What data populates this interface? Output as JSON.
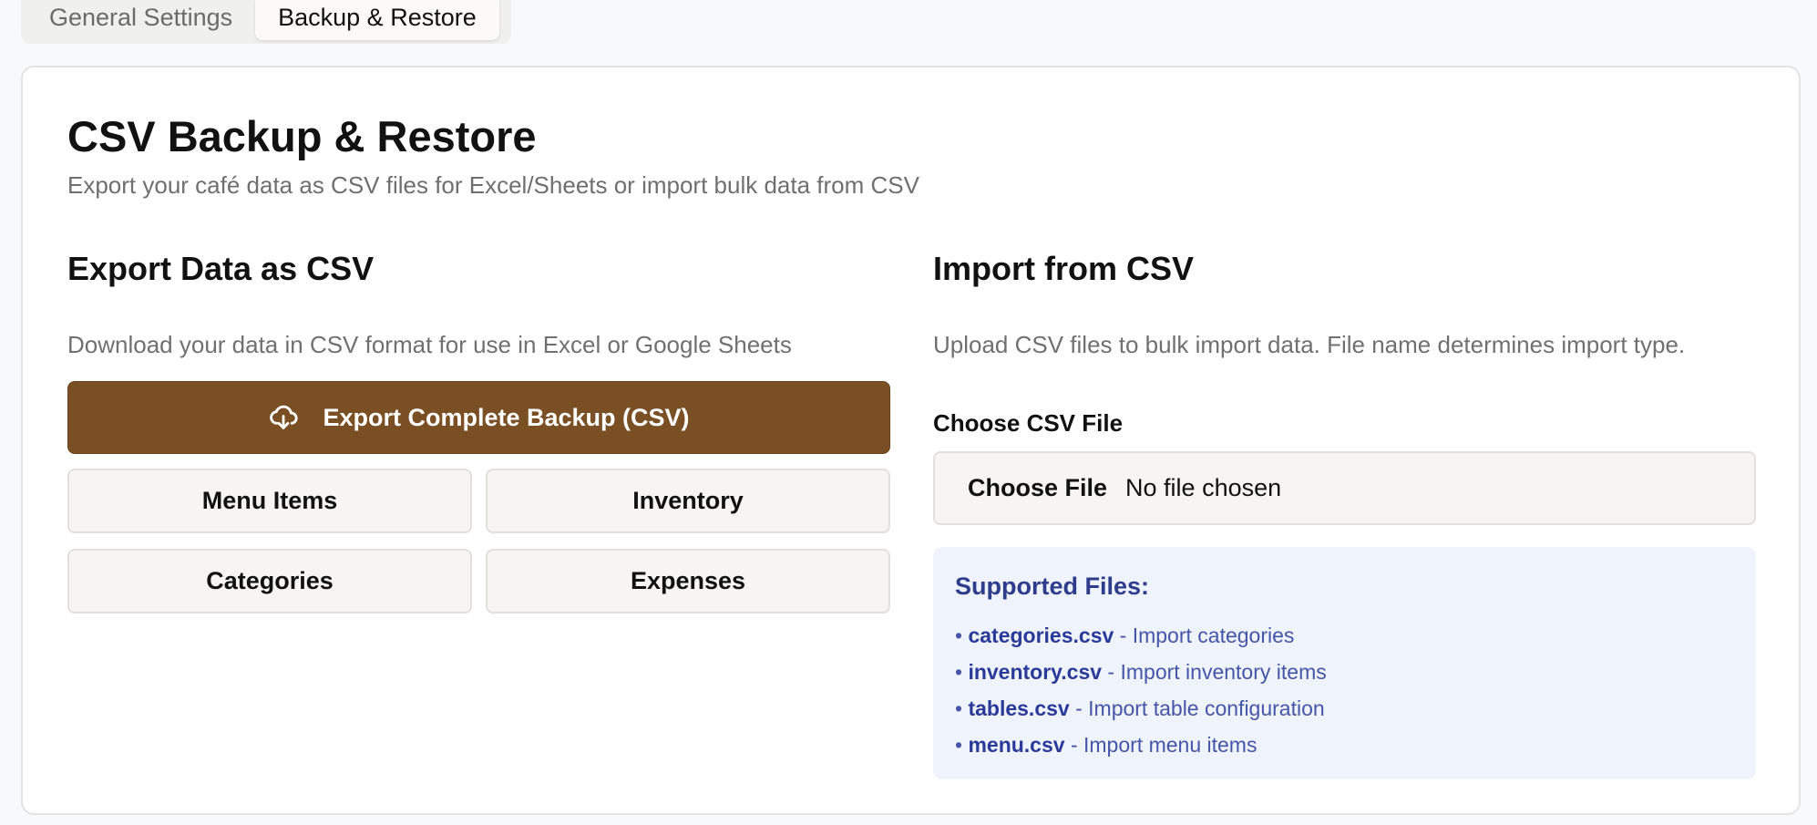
{
  "tabs": [
    {
      "label": "General Settings",
      "active": false
    },
    {
      "label": "Backup & Restore",
      "active": true
    }
  ],
  "page": {
    "title": "CSV Backup & Restore",
    "subtitle": "Export your café data as CSV files for Excel/Sheets or import bulk data from CSV"
  },
  "export": {
    "title": "Export Data as CSV",
    "description": "Download your data in CSV format for use in Excel or Google Sheets",
    "main_button": {
      "label": "Export Complete Backup (CSV)",
      "icon": "cloud-download-icon"
    },
    "buttons": [
      {
        "label": "Menu Items"
      },
      {
        "label": "Inventory"
      },
      {
        "label": "Categories"
      },
      {
        "label": "Expenses"
      }
    ]
  },
  "import": {
    "title": "Import from CSV",
    "description": "Upload CSV files to bulk import data. File name determines import type.",
    "field_label": "Choose CSV File",
    "choose_button": "Choose File",
    "file_status": "No file chosen",
    "supported": {
      "title": "Supported Files:",
      "bullet": "•",
      "items": [
        {
          "file": "categories.csv",
          "desc": " - Import categories"
        },
        {
          "file": "inventory.csv",
          "desc": " - Import inventory items"
        },
        {
          "file": "tables.csv",
          "desc": " - Import table configuration"
        },
        {
          "file": "menu.csv",
          "desc": " - Import menu items"
        }
      ]
    }
  },
  "colors": {
    "primary": "#7a4f24",
    "info_bg": "#eef3fc",
    "info_text": "#2a3a98"
  }
}
